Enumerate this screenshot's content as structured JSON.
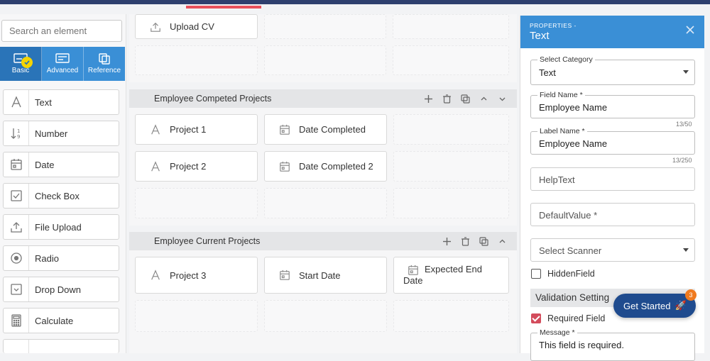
{
  "sidebar": {
    "search_placeholder": "Search an element",
    "tabs": [
      {
        "label": "Basic",
        "icon": "basic-form-icon",
        "active": true
      },
      {
        "label": "Advanced",
        "icon": "advanced-form-icon",
        "active": false
      },
      {
        "label": "Reference",
        "icon": "reference-copy-icon",
        "active": false
      }
    ],
    "items": [
      {
        "label": "Text",
        "icon": "text-a-icon"
      },
      {
        "label": "Number",
        "icon": "number-sort-icon"
      },
      {
        "label": "Date",
        "icon": "calendar-icon"
      },
      {
        "label": "Check Box",
        "icon": "checkbox-icon"
      },
      {
        "label": "File Upload",
        "icon": "upload-icon"
      },
      {
        "label": "Radio",
        "icon": "radio-icon"
      },
      {
        "label": "Drop Down",
        "icon": "dropdown-icon"
      },
      {
        "label": "Calculate",
        "icon": "calculator-icon"
      }
    ]
  },
  "canvas": {
    "upload_cv": "Upload CV",
    "sections": [
      {
        "title": "Employee Competed Projects",
        "fields": [
          {
            "label": "Project 1",
            "icon": "text-a-icon"
          },
          {
            "label": "Date Completed",
            "icon": "calendar-icon"
          },
          {
            "label": "Project 2",
            "icon": "text-a-icon"
          },
          {
            "label": "Date Completed 2",
            "icon": "calendar-icon"
          }
        ]
      },
      {
        "title": "Employee Current Projects",
        "fields": [
          {
            "label": "Project 3",
            "icon": "text-a-icon"
          },
          {
            "label": "Start Date",
            "icon": "calendar-icon"
          },
          {
            "label": "Expected End Date",
            "icon": "calendar-icon"
          }
        ]
      }
    ]
  },
  "properties": {
    "header_small": "PROPERTIES -",
    "header_title": "Text",
    "select_category_label": "Select Category",
    "select_category_value": "Text",
    "field_name_label": "Field Name *",
    "field_name_value": "Employee Name",
    "field_name_counter": "13/50",
    "label_name_label": "Label Name *",
    "label_name_value": "Employee Name",
    "label_name_counter": "13/250",
    "helptext_placeholder": "HelpText",
    "default_value_placeholder": "DefaultValue *",
    "select_scanner_value": "Select Scanner",
    "hidden_field_label": "HiddenField",
    "hidden_field_checked": false,
    "validation_title": "Validation Setting",
    "required_field_label": "Required Field",
    "required_field_checked": true,
    "message_label": "Message *",
    "message_value": "This field is required."
  },
  "get_started": {
    "label": "Get Started",
    "badge": "3",
    "icon": "rocket-icon"
  },
  "colors": {
    "accent": "#3a8fd6",
    "header_bar": "#2e3f6e",
    "get_started": "#1f4b8e",
    "required_check": "#d34c5c"
  }
}
